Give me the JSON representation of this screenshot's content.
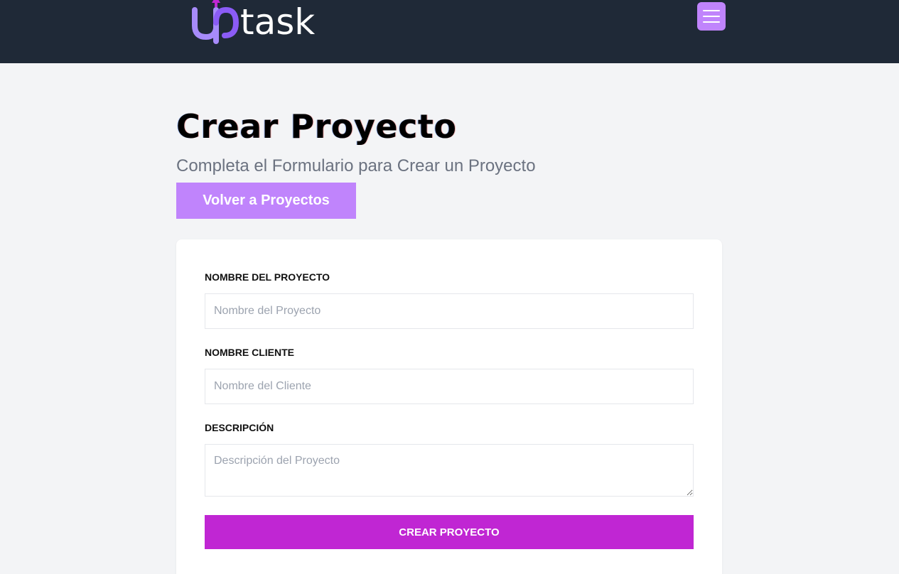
{
  "header": {
    "logo_text": "uptask",
    "menu_icon": "hamburger-menu-icon",
    "colors": {
      "background": "#1f2937",
      "logo_accent": "#a78bfa",
      "menu_button": "#c084fc"
    }
  },
  "page": {
    "title": "Crear Proyecto",
    "subtitle": "Completa el Formulario para Crear un Proyecto",
    "back_button_label": "Volver a Proyectos"
  },
  "form": {
    "fields": [
      {
        "label": "Nombre del Proyecto",
        "placeholder": "Nombre del Proyecto",
        "value": ""
      },
      {
        "label": "Nombre Cliente",
        "placeholder": "Nombre del Cliente",
        "value": ""
      },
      {
        "label": "Descripción",
        "placeholder": "Descripción del Proyecto",
        "value": ""
      }
    ],
    "submit_label": "Crear Proyecto",
    "colors": {
      "submit": "#c026d3",
      "back_button": "#c084fc"
    }
  }
}
